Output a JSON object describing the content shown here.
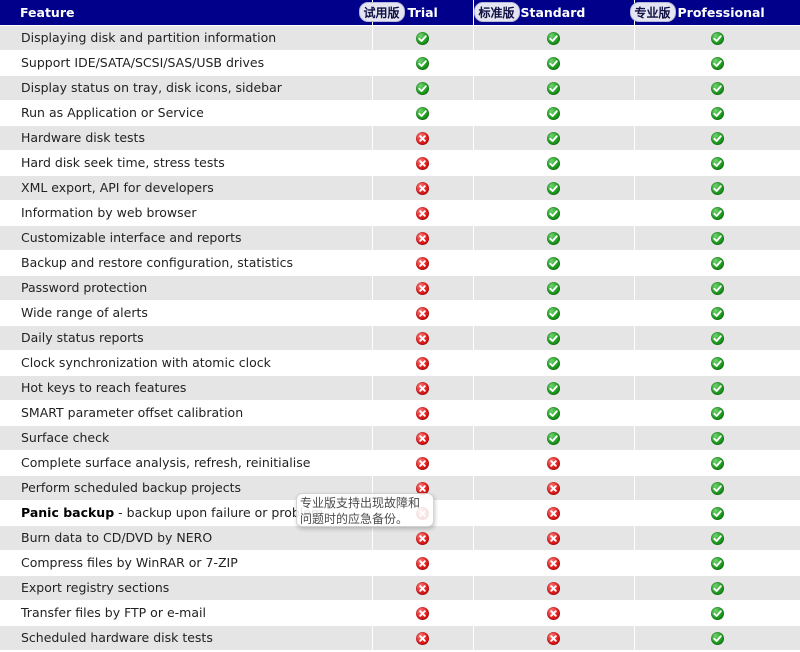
{
  "header": {
    "feature": "Feature",
    "trial": {
      "badge": "试用版",
      "title": "Trial"
    },
    "standard": {
      "badge": "标准版",
      "title": "Standard"
    },
    "professional": {
      "badge": "专业版",
      "title": "Professional"
    }
  },
  "icons": {
    "yes": "check-circle-icon",
    "no": "cross-circle-icon"
  },
  "colors": {
    "header_bg": "#00008b",
    "row_alt": "#e5e5e5",
    "yes": "#1f9a1f",
    "no": "#e01a1a"
  },
  "rows": [
    {
      "feature": "Displaying disk and partition information",
      "trial": "yes",
      "standard": "yes",
      "professional": "yes"
    },
    {
      "feature": "Support IDE/SATA/SCSI/SAS/USB drives",
      "trial": "yes",
      "standard": "yes",
      "professional": "yes"
    },
    {
      "feature": "Display status on tray, disk icons, sidebar",
      "trial": "yes",
      "standard": "yes",
      "professional": "yes"
    },
    {
      "feature": "Run as Application or Service",
      "trial": "yes",
      "standard": "yes",
      "professional": "yes"
    },
    {
      "feature": "Hardware disk tests",
      "trial": "no",
      "standard": "yes",
      "professional": "yes"
    },
    {
      "feature": "Hard disk seek time, stress tests",
      "trial": "no",
      "standard": "yes",
      "professional": "yes"
    },
    {
      "feature": "XML export, API for developers",
      "trial": "no",
      "standard": "yes",
      "professional": "yes"
    },
    {
      "feature": "Information by web browser",
      "trial": "no",
      "standard": "yes",
      "professional": "yes"
    },
    {
      "feature": "Customizable interface and reports",
      "trial": "no",
      "standard": "yes",
      "professional": "yes"
    },
    {
      "feature": "Backup and restore configuration, statistics",
      "trial": "no",
      "standard": "yes",
      "professional": "yes"
    },
    {
      "feature": "Password protection",
      "trial": "no",
      "standard": "yes",
      "professional": "yes"
    },
    {
      "feature": "Wide range of alerts",
      "trial": "no",
      "standard": "yes",
      "professional": "yes"
    },
    {
      "feature": "Daily status reports",
      "trial": "no",
      "standard": "yes",
      "professional": "yes"
    },
    {
      "feature": "Clock synchronization with atomic clock",
      "trial": "no",
      "standard": "yes",
      "professional": "yes"
    },
    {
      "feature": "Hot keys to reach features",
      "trial": "no",
      "standard": "yes",
      "professional": "yes"
    },
    {
      "feature": "SMART parameter offset calibration",
      "trial": "no",
      "standard": "yes",
      "professional": "yes"
    },
    {
      "feature": "Surface check",
      "trial": "no",
      "standard": "yes",
      "professional": "yes"
    },
    {
      "feature": "Complete surface analysis, refresh, reinitialise",
      "trial": "no",
      "standard": "no",
      "professional": "yes"
    },
    {
      "feature": "Perform scheduled backup projects",
      "trial": "no",
      "standard": "no",
      "professional": "yes"
    },
    {
      "feature_bold": "Panic backup",
      "feature": " - backup upon failure or problem",
      "trial": "no",
      "standard": "no",
      "professional": "yes"
    },
    {
      "feature": "Burn data to CD/DVD by NERO",
      "trial": "no",
      "standard": "no",
      "professional": "yes"
    },
    {
      "feature": "Compress files by WinRAR or 7-ZIP",
      "trial": "no",
      "standard": "no",
      "professional": "yes"
    },
    {
      "feature": "Export registry sections",
      "trial": "no",
      "standard": "no",
      "professional": "yes"
    },
    {
      "feature": "Transfer files by FTP or e-mail",
      "trial": "no",
      "standard": "no",
      "professional": "yes"
    },
    {
      "feature": "Scheduled hardware disk tests",
      "trial": "no",
      "standard": "no",
      "professional": "yes"
    }
  ],
  "tooltip": {
    "line1": "专业版支持出现故障和",
    "line2": "问题时的应急备份。"
  }
}
